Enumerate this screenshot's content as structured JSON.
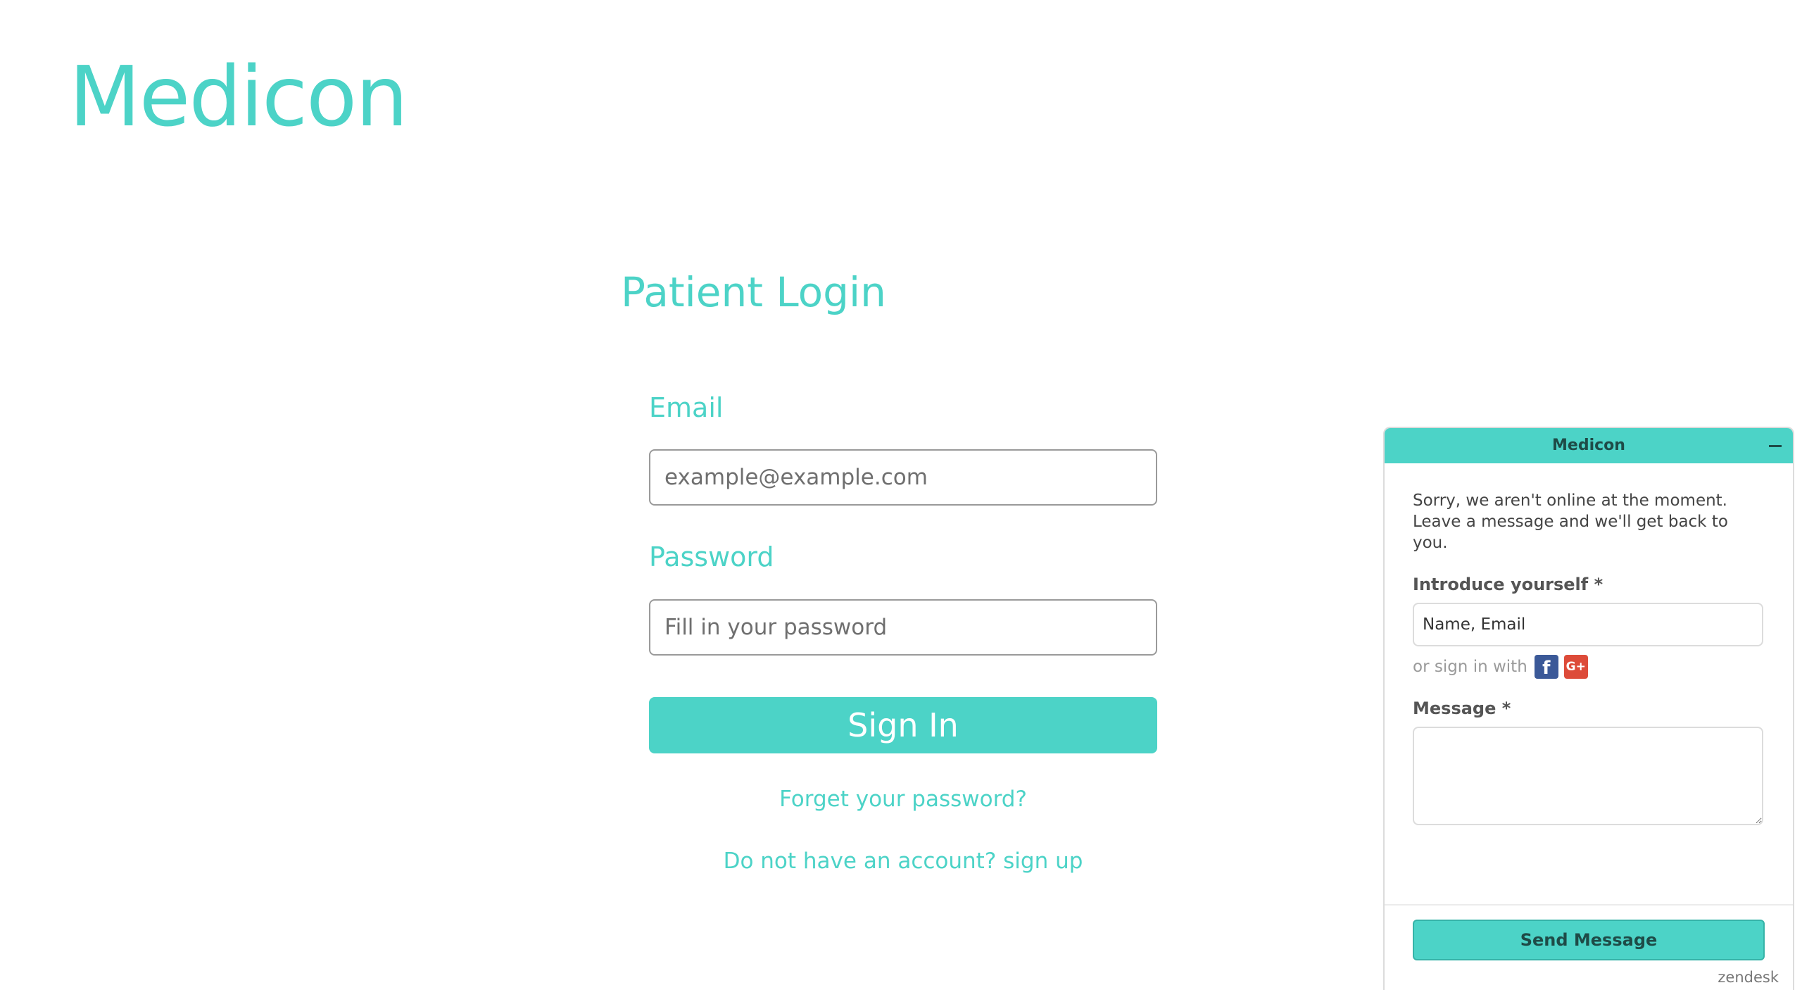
{
  "brand": {
    "logo_text": "Medicon"
  },
  "login": {
    "title": "Patient Login",
    "email_label": "Email",
    "email_placeholder": "example@example.com",
    "password_label": "Password",
    "password_placeholder": "Fill in your password",
    "signin_label": "Sign In",
    "forgot_link": "Forget your password?",
    "signup_link": "Do not have an account? sign up"
  },
  "chat_widget": {
    "title": "Medicon",
    "offline_message": "Sorry, we aren't online at the moment. Leave a message and we'll get back to you.",
    "introduce_label": "Introduce yourself *",
    "introduce_placeholder": "Name, Email",
    "social_prompt": "or sign in with",
    "social_icons": [
      "facebook-icon",
      "google-plus-icon"
    ],
    "facebook_glyph": "f",
    "google_glyph": "G+",
    "message_label": "Message *",
    "send_label": "Send Message",
    "powered_by": "zendesk"
  },
  "colors": {
    "accent": "#4cd3c7",
    "header_text": "#1e4b47",
    "facebook": "#3b5998",
    "google_plus": "#dd4b39"
  }
}
